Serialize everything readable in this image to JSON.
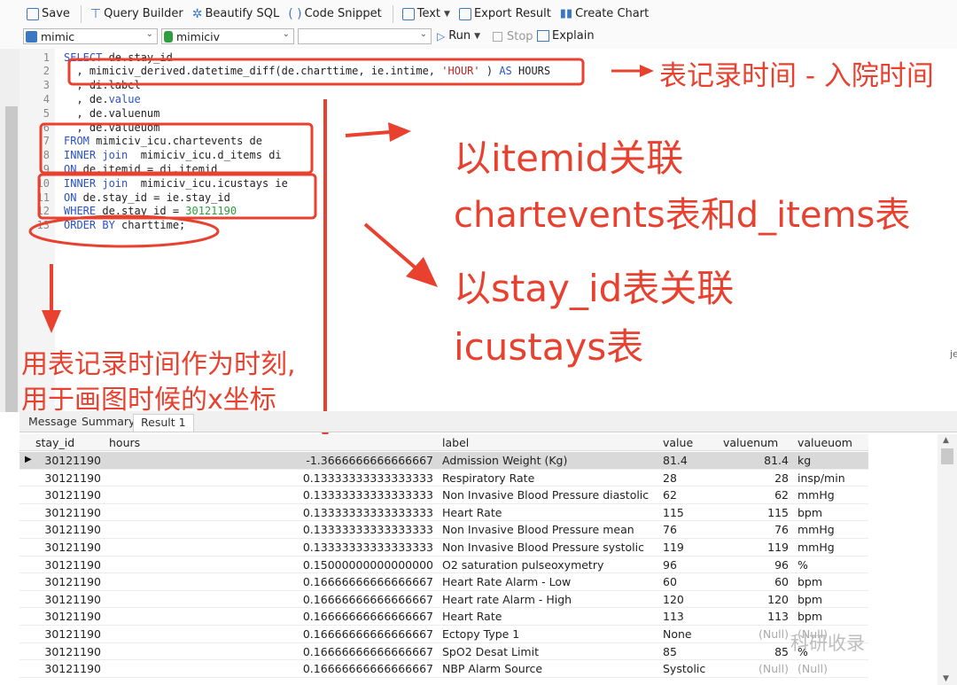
{
  "toolbar": {
    "save": "Save",
    "query_builder": "Query Builder",
    "beautify": "Beautify SQL",
    "snippet": "Code Snippet",
    "text": "Text",
    "export": "Export Result",
    "create_chart": "Create Chart"
  },
  "connection": {
    "value": "mimic"
  },
  "database": {
    "value": "mimiciv"
  },
  "schema": {
    "value": ""
  },
  "run": "Run",
  "stop": "Stop",
  "explain": "Explain",
  "code": {
    "l1": {
      "n": "1",
      "kw": "SELECT",
      "rest": " de.stay_id"
    },
    "l2": {
      "n": "2",
      "a": "  , mimiciv_derived.datetime_diff(de.charttime, ie.intime, ",
      "s": "'HOUR'",
      "b": " ) ",
      "kw": "AS",
      "c": " HOURS"
    },
    "l3": {
      "n": "3",
      "t": "  , di.label"
    },
    "l4": {
      "n": "4",
      "a": "  , de.",
      "kw": "value"
    },
    "l5": {
      "n": "5",
      "t": "  , de.valuenum"
    },
    "l6": {
      "n": "6",
      "t": "  , de.valueuom"
    },
    "l7": {
      "n": "7",
      "kw": "FROM",
      "rest": " mimiciv_icu.chartevents de"
    },
    "l8": {
      "n": "8",
      "kw": "INNER join",
      "rest": "  mimiciv_icu.d_items di"
    },
    "l9": {
      "n": "9",
      "kw": "ON",
      "rest": " de.itemid = di.itemid"
    },
    "l10": {
      "n": "10",
      "kw": "INNER join",
      "rest": "  mimiciv_icu.icustays ie"
    },
    "l11": {
      "n": "11",
      "kw": "ON",
      "rest": " de.stay_id = ie.stay_id"
    },
    "l12": {
      "n": "12",
      "kw": "WHERE",
      "rest": " de.stay_id = ",
      "num": "30121190"
    },
    "l13": {
      "n": "13",
      "kw": "ORDER BY",
      "rest": " charttime;"
    }
  },
  "annotations": {
    "a1": "表记录时间 -  入院时间",
    "a2": "以itemid关联",
    "a3": "chartevents表和d_items表",
    "a4": "以stay_id表关联",
    "a5": "icustays表",
    "a6": "用表记录时间作为时刻,",
    "a7": "用于画图时候的x坐标"
  },
  "tabs": {
    "message": "Message",
    "summary": "Summary",
    "result": "Result 1"
  },
  "columns": [
    "stay_id",
    "hours",
    "label",
    "value",
    "valuenum",
    "valueuom"
  ],
  "rows": [
    [
      "30121190",
      "-1.3666666666666667",
      "Admission Weight (Kg)",
      "81.4",
      "81.4",
      "kg"
    ],
    [
      "30121190",
      "0.13333333333333333",
      "Respiratory Rate",
      "28",
      "28",
      "insp/min"
    ],
    [
      "30121190",
      "0.13333333333333333",
      "Non Invasive Blood Pressure diastolic",
      "62",
      "62",
      "mmHg"
    ],
    [
      "30121190",
      "0.13333333333333333",
      "Heart Rate",
      "115",
      "115",
      "bpm"
    ],
    [
      "30121190",
      "0.13333333333333333",
      "Non Invasive Blood Pressure mean",
      "76",
      "76",
      "mmHg"
    ],
    [
      "30121190",
      "0.13333333333333333",
      "Non Invasive Blood Pressure systolic",
      "119",
      "119",
      "mmHg"
    ],
    [
      "30121190",
      "0.15000000000000000",
      "O2 saturation pulseoxymetry",
      "96",
      "96",
      "%"
    ],
    [
      "30121190",
      "0.16666666666666667",
      "Heart Rate Alarm - Low",
      "60",
      "60",
      "bpm"
    ],
    [
      "30121190",
      "0.16666666666666667",
      "Heart rate Alarm - High",
      "120",
      "120",
      "bpm"
    ],
    [
      "30121190",
      "0.16666666666666667",
      "Heart Rate",
      "113",
      "113",
      "bpm"
    ],
    [
      "30121190",
      "0.16666666666666667",
      "Ectopy Type 1",
      "None",
      "(Null)",
      "(Null)"
    ],
    [
      "30121190",
      "0.16666666666666667",
      "SpO2 Desat Limit",
      "85",
      "85",
      "%"
    ],
    [
      "30121190",
      "0.16666666666666667",
      "NBP Alarm Source",
      "Systolic",
      "(Null)",
      "(Null)"
    ]
  ],
  "watermark": "科研收录",
  "edge_text": "je",
  "colors": {
    "annotation": "#e8412f",
    "keyword": "#2a52c8",
    "string": "#b5282a",
    "number": "#2e9e3e",
    "selected_row": "#d9d9d9"
  }
}
